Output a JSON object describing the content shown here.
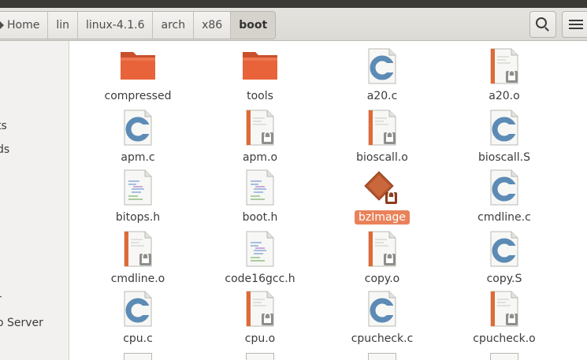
{
  "breadcrumbs": [
    "Home",
    "lin",
    "linux-4.1.6",
    "arch",
    "x86",
    "boot"
  ],
  "sidebar": {
    "items": [
      "ts",
      "ds",
      "r",
      "o Server"
    ]
  },
  "files": [
    {
      "name": "compressed",
      "type": "folder"
    },
    {
      "name": "tools",
      "type": "folder"
    },
    {
      "name": "a20.c",
      "type": "c-source"
    },
    {
      "name": "a20.o",
      "type": "object"
    },
    {
      "name": "apm.c",
      "type": "c-source"
    },
    {
      "name": "apm.o",
      "type": "object"
    },
    {
      "name": "bioscall.o",
      "type": "object"
    },
    {
      "name": "bioscall.S",
      "type": "c-source"
    },
    {
      "name": "bitops.h",
      "type": "header"
    },
    {
      "name": "boot.h",
      "type": "header"
    },
    {
      "name": "bzImage",
      "type": "binary",
      "selected": true
    },
    {
      "name": "cmdline.c",
      "type": "c-source"
    },
    {
      "name": "cmdline.o",
      "type": "object"
    },
    {
      "name": "code16gcc.h",
      "type": "header"
    },
    {
      "name": "copy.o",
      "type": "object"
    },
    {
      "name": "copy.S",
      "type": "c-source"
    },
    {
      "name": "cpu.c",
      "type": "c-source"
    },
    {
      "name": "cpu.o",
      "type": "object"
    },
    {
      "name": "cpucheck.c",
      "type": "c-source"
    },
    {
      "name": "cpucheck.o",
      "type": "object"
    }
  ],
  "colors": {
    "folder": "#e8633a",
    "selection": "#e9825a",
    "c_letter": "#5c8bb5"
  }
}
